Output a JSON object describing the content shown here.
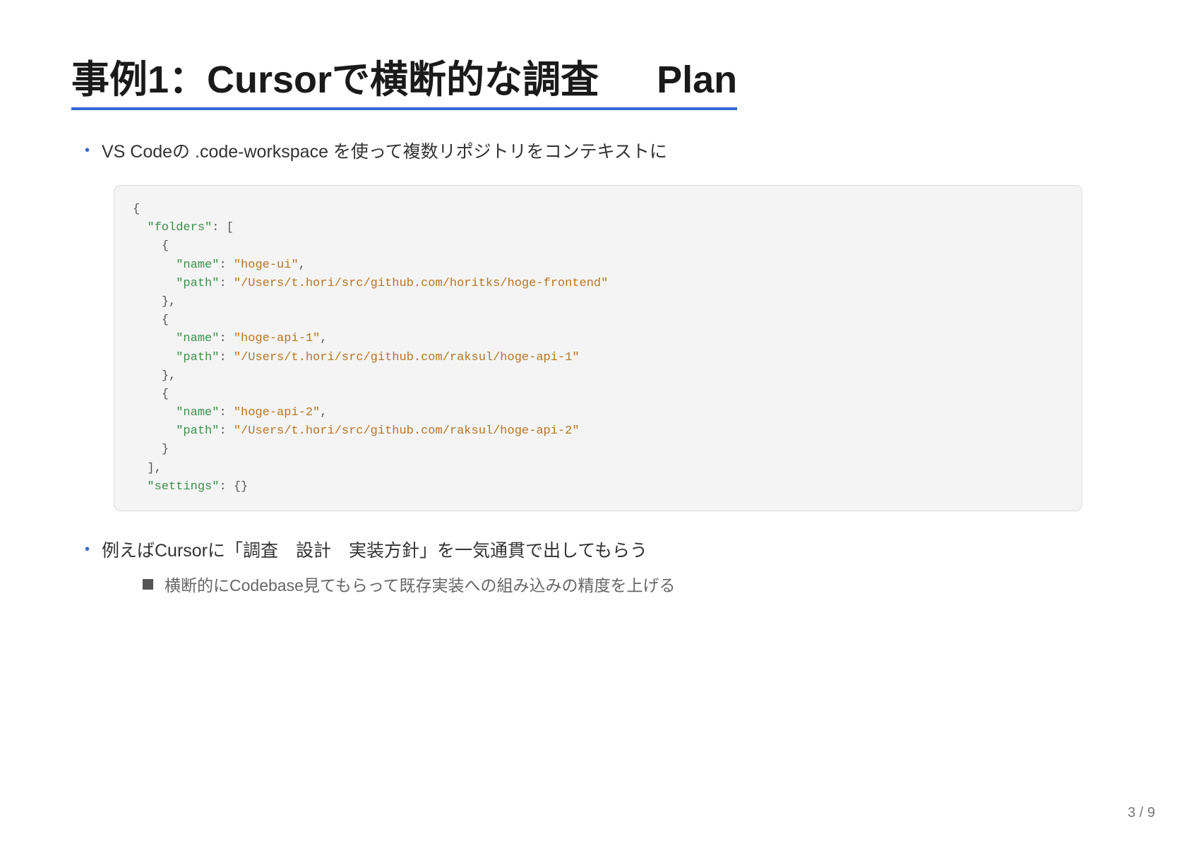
{
  "slide": {
    "title_main": "事例1：Cursorで横断的な調査",
    "title_tag": "Plan",
    "bullet1": "VS Codeの .code-workspace を使って複数リポジトリをコンテキストに",
    "bullet2": "例えばCursorに「調査　設計　実装方針」を一気通貫で出してもらう",
    "sub_bullet": "横断的にCodebase見てもらって既存実装への組み込みの精度を上げる",
    "page_number": "3 / 9"
  },
  "code": {
    "lines": [
      {
        "indent": "",
        "segments": [
          {
            "text": "{",
            "cls": "p"
          }
        ]
      },
      {
        "indent": "  ",
        "segments": [
          {
            "text": "\"folders\"",
            "cls": "k"
          },
          {
            "text": ": [",
            "cls": "p"
          }
        ]
      },
      {
        "indent": "    ",
        "segments": [
          {
            "text": "{",
            "cls": "p"
          }
        ]
      },
      {
        "indent": "      ",
        "segments": [
          {
            "text": "\"name\"",
            "cls": "k"
          },
          {
            "text": ": ",
            "cls": "p"
          },
          {
            "text": "\"hoge-ui\"",
            "cls": "s"
          },
          {
            "text": ",",
            "cls": "p"
          }
        ]
      },
      {
        "indent": "      ",
        "segments": [
          {
            "text": "\"path\"",
            "cls": "k"
          },
          {
            "text": ": ",
            "cls": "p"
          },
          {
            "text": "\"/Users/t.hori/src/github.com/horitks/hoge-frontend\"",
            "cls": "s"
          }
        ]
      },
      {
        "indent": "    ",
        "segments": [
          {
            "text": "},",
            "cls": "p"
          }
        ]
      },
      {
        "indent": "    ",
        "segments": [
          {
            "text": "{",
            "cls": "p"
          }
        ]
      },
      {
        "indent": "      ",
        "segments": [
          {
            "text": "\"name\"",
            "cls": "k"
          },
          {
            "text": ": ",
            "cls": "p"
          },
          {
            "text": "\"hoge-api-1\"",
            "cls": "s"
          },
          {
            "text": ",",
            "cls": "p"
          }
        ]
      },
      {
        "indent": "      ",
        "segments": [
          {
            "text": "\"path\"",
            "cls": "k"
          },
          {
            "text": ": ",
            "cls": "p"
          },
          {
            "text": "\"/Users/t.hori/src/github.com/raksul/hoge-api-1\"",
            "cls": "s"
          }
        ]
      },
      {
        "indent": "    ",
        "segments": [
          {
            "text": "},",
            "cls": "p"
          }
        ]
      },
      {
        "indent": "    ",
        "segments": [
          {
            "text": "{",
            "cls": "p"
          }
        ]
      },
      {
        "indent": "      ",
        "segments": [
          {
            "text": "\"name\"",
            "cls": "k"
          },
          {
            "text": ": ",
            "cls": "p"
          },
          {
            "text": "\"hoge-api-2\"",
            "cls": "s"
          },
          {
            "text": ",",
            "cls": "p"
          }
        ]
      },
      {
        "indent": "      ",
        "segments": [
          {
            "text": "\"path\"",
            "cls": "k"
          },
          {
            "text": ": ",
            "cls": "p"
          },
          {
            "text": "\"/Users/t.hori/src/github.com/raksul/hoge-api-2\"",
            "cls": "s"
          }
        ]
      },
      {
        "indent": "    ",
        "segments": [
          {
            "text": "}",
            "cls": "p"
          }
        ]
      },
      {
        "indent": "  ",
        "segments": [
          {
            "text": "],",
            "cls": "p"
          }
        ]
      },
      {
        "indent": "  ",
        "segments": [
          {
            "text": "\"settings\"",
            "cls": "k"
          },
          {
            "text": ": {}",
            "cls": "p"
          }
        ]
      }
    ]
  },
  "colors": {
    "accent": "#2f67d8",
    "code_key": "#3c8f4c",
    "code_string": "#b87523",
    "code_background": "#f4f4f4"
  }
}
